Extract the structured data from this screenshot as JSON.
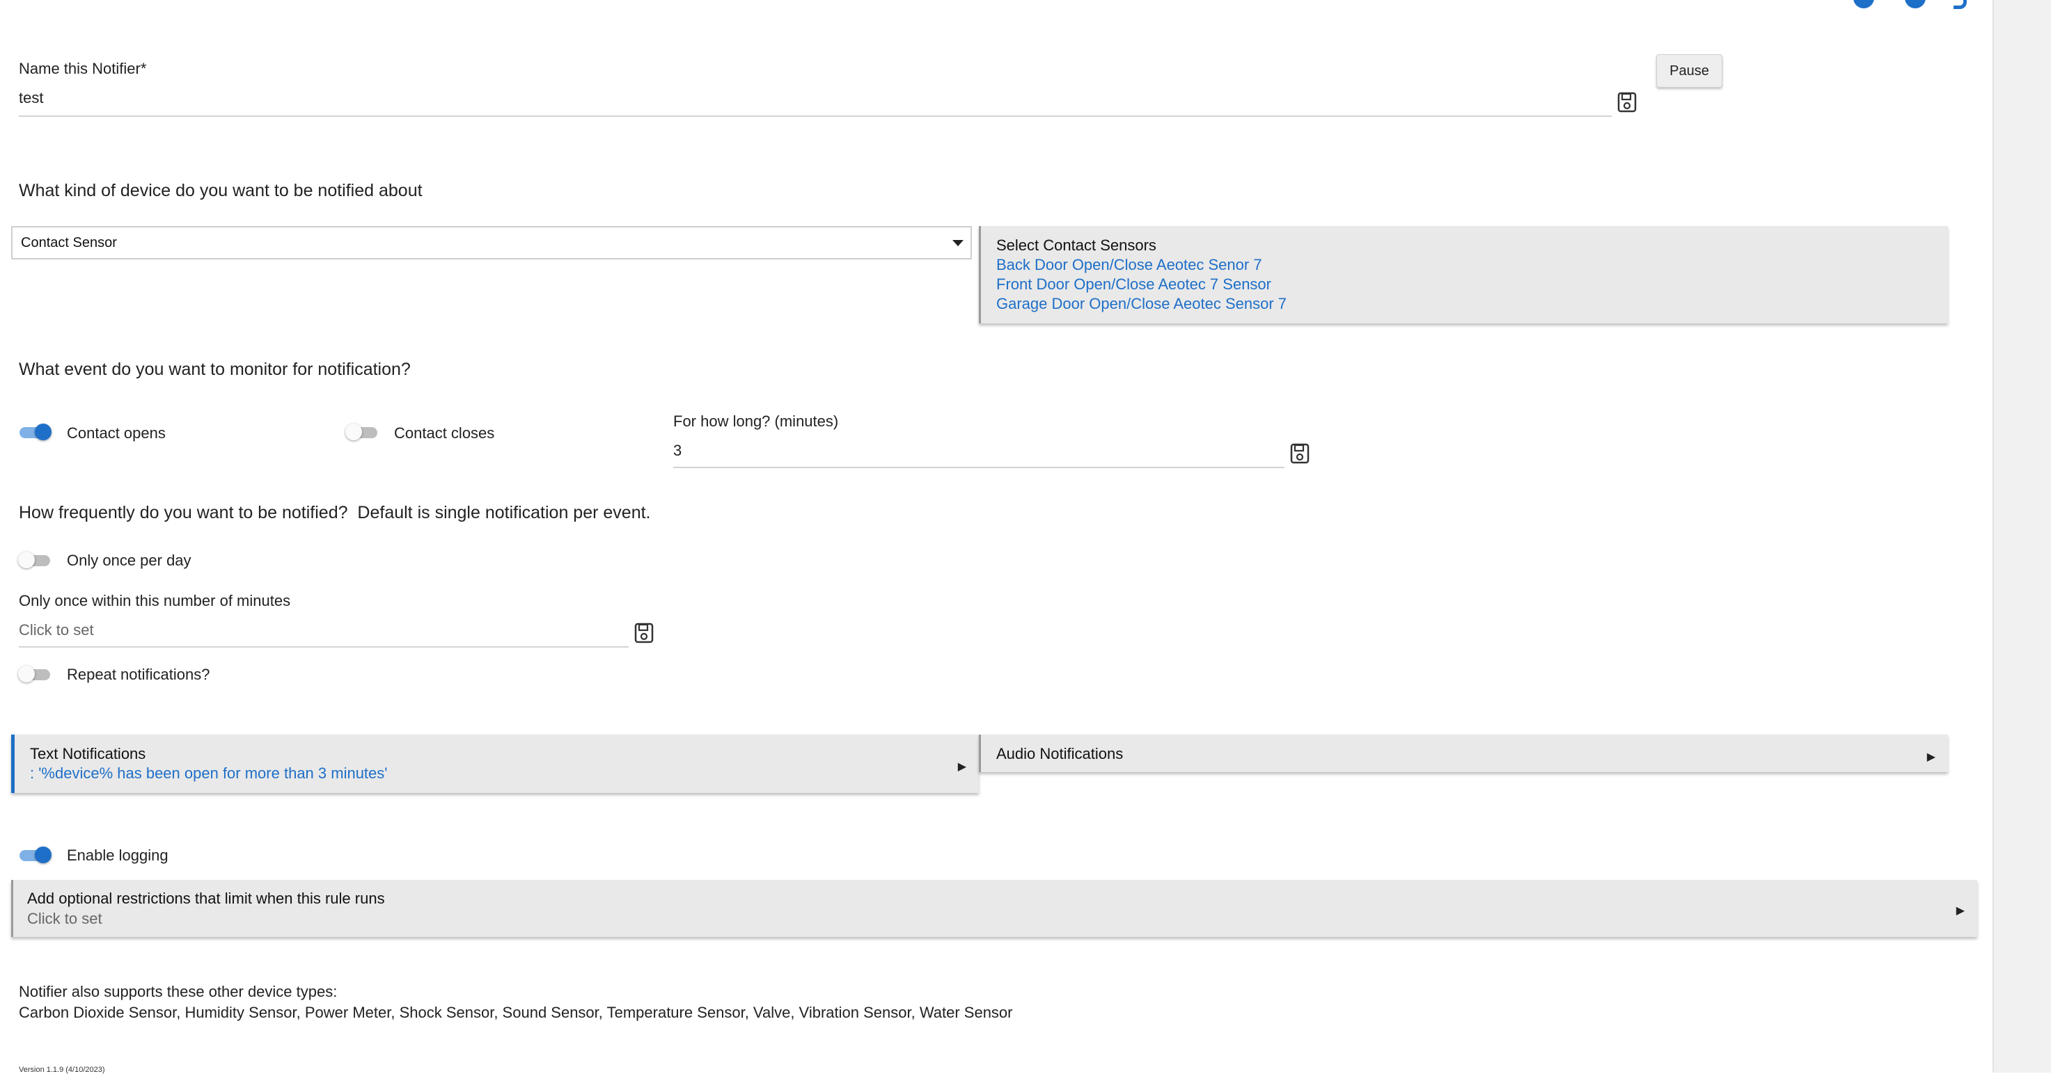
{
  "name_section": {
    "label": "Name this Notifier*",
    "value": "test",
    "pause_label": "Pause"
  },
  "device_section": {
    "question": "What kind of device do you want to be notified about",
    "selected_type": "Contact Sensor",
    "sensors_title": "Select Contact Sensors",
    "sensors": [
      "Back Door Open/Close Aeotec Senor 7",
      "Front Door Open/Close Aeotec 7 Sensor",
      "Garage Door Open/Close Aeotec Sensor 7"
    ]
  },
  "event_section": {
    "question": "What event do you want to monitor for notification?",
    "contact_opens": {
      "label": "Contact opens",
      "on": true
    },
    "contact_closes": {
      "label": "Contact closes",
      "on": false
    },
    "duration_label": "For how long? (minutes)",
    "duration_value": "3"
  },
  "frequency_section": {
    "question": "How frequently do you want to be notified?  Default is single notification per event.",
    "once_per_day": {
      "label": "Only once per day",
      "on": false
    },
    "minutes_label": "Only once within this number of minutes",
    "minutes_placeholder": "Click to set",
    "repeat": {
      "label": "Repeat notifications?",
      "on": false
    }
  },
  "notifications": {
    "text_title": "Text Notifications",
    "text_value": ": '%device% has been open for more than 3 minutes'",
    "audio_title": "Audio Notifications"
  },
  "logging": {
    "label": "Enable logging",
    "on": true
  },
  "restrictions": {
    "title": "Add optional restrictions that limit when this rule runs",
    "placeholder": "Click to set"
  },
  "footer": {
    "supports_label": "Notifier also supports these other device types:",
    "supports_list": "Carbon Dioxide Sensor, Humidity Sensor, Power Meter, Shock Sensor, Sound Sensor, Temperature Sensor, Valve, Vibration Sensor, Water Sensor",
    "version": "Version 1.1.9 (4/10/2023)"
  },
  "colors": {
    "accent": "#1e6fc8",
    "panel_bg": "#e9e9e9",
    "link": "#1e6fc8"
  },
  "icons": [
    "gear-icon",
    "info-icon",
    "help-icon",
    "save-icon",
    "dropdown-arrow-icon",
    "expand-arrow-icon"
  ]
}
